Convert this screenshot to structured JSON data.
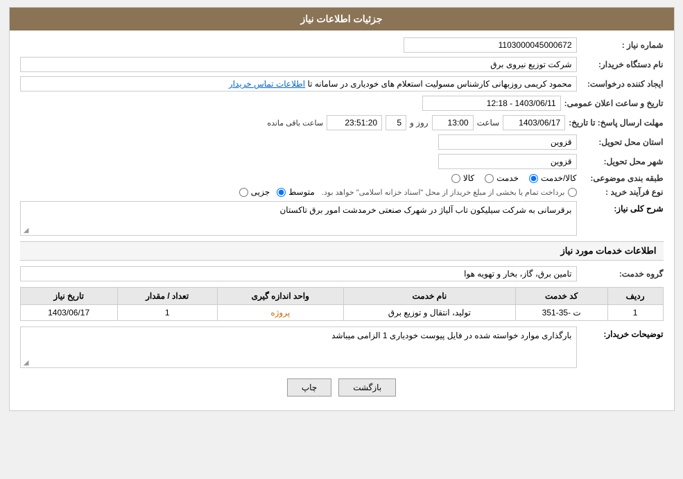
{
  "header": {
    "title": "جزئیات اطلاعات نیاز"
  },
  "fields": {
    "need_number_label": "شماره نیاز :",
    "need_number_value": "1103000045000672",
    "buyer_org_label": "نام دستگاه خریدار:",
    "buyer_org_value": "شرکت توزیع نیروی برق",
    "requester_label": "ایجاد کننده درخواست:",
    "requester_value": "محمود کریمی روزبهانی کارشناس  مسولیت استعلام های خودیاری در سامانه تا",
    "requester_link": "اطلاعات تماس خریدار",
    "announce_label": "تاریخ و ساعت اعلان عمومی:",
    "announce_value": "1403/06/11 - 12:18",
    "reply_deadline_label": "مهلت ارسال پاسخ: تا تاریخ:",
    "reply_date": "1403/06/17",
    "reply_time_label": "ساعت",
    "reply_time": "13:00",
    "reply_day_label": "روز و",
    "reply_days": "5",
    "reply_remaining_label": "ساعت باقی مانده",
    "reply_remaining": "23:51:20",
    "province_label": "استان محل تحویل:",
    "province_value": "قزوین",
    "city_label": "شهر محل تحویل:",
    "city_value": "قزوین",
    "category_label": "طبقه بندی موضوعی:",
    "category_options": [
      {
        "label": "کالا",
        "value": "kala",
        "selected": false
      },
      {
        "label": "خدمت",
        "value": "khedmat",
        "selected": false
      },
      {
        "label": "کالا/خدمت",
        "value": "both",
        "selected": true
      }
    ],
    "purchase_type_label": "نوع فرآیند خرید :",
    "purchase_options": [
      {
        "label": "جزیی",
        "value": "jozi",
        "selected": false
      },
      {
        "label": "متوسط",
        "value": "mottavaset",
        "selected": true
      },
      {
        "label": "برداخت تمام یا بخشی از مبلغ خریدار از محل \"اسناد خزانه اسلامی\" خواهد بود.",
        "value": "esnad",
        "selected": false
      }
    ],
    "description_label": "شرح کلی نیاز:",
    "description_value": "برقرسانی به شرکت سیلیکون تاب آلیاژ در شهرک صنعتی خرمدشت امور برق تاکستان"
  },
  "services_section": {
    "title": "اطلاعات خدمات مورد نیاز",
    "service_group_label": "گروه خدمت:",
    "service_group_value": "تامین برق، گاز، بخار و تهویه هوا",
    "table": {
      "columns": [
        "ردیف",
        "کد خدمت",
        "نام خدمت",
        "واحد اندازه گیری",
        "تعداد / مقدار",
        "تاریخ نیاز"
      ],
      "rows": [
        {
          "row_num": "1",
          "service_code": "ت -35-351",
          "service_name": "تولید، انتقال و توزیع برق",
          "unit": "پروژه",
          "quantity": "1",
          "date": "1403/06/17"
        }
      ]
    }
  },
  "buyer_notes_label": "توضیحات خریدار:",
  "buyer_notes_value": "بارگذاری موارد خواسته شده در فایل پیوست خودیاری 1 الزامی میباشد",
  "buttons": {
    "print_label": "چاپ",
    "back_label": "بازگشت"
  }
}
